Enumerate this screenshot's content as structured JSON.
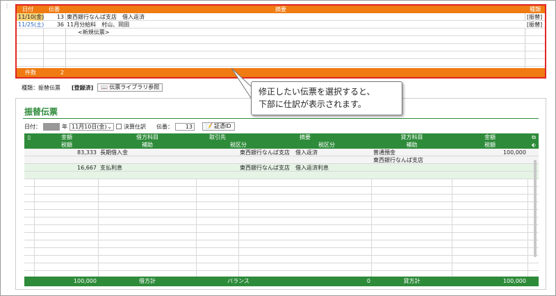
{
  "list": {
    "headers": {
      "date": "日付",
      "slip_no": "伝番",
      "summary": "摘要",
      "kind": "種類"
    },
    "rows": [
      {
        "date": "11/10(金)",
        "slip_no": "13",
        "summary": "東西銀行なんば支店　借入返済",
        "kind": "[振替]"
      },
      {
        "date": "11/25(土)",
        "slip_no": "36",
        "summary": "11月分給料　村山、岡田",
        "kind": "[振替]"
      },
      {
        "date": "",
        "slip_no": "",
        "summary": "<新規伝票>",
        "kind": ""
      }
    ],
    "footer": {
      "label": "件数",
      "count": "2"
    }
  },
  "info": {
    "kind": "種類：振替伝票",
    "status": "[登録済]",
    "library_button": "伝票ライブラリ参照"
  },
  "callout": {
    "line1": "修正したい伝票を選択すると、",
    "line2": "下部に仕訳が表示されます。"
  },
  "form": {
    "title": "振替伝票",
    "date_label": "日付：",
    "year_suffix": "年",
    "date_value": "11月10日(金)",
    "closing_label": "決算仕訳",
    "slip_label": "伝番：",
    "slip_value": "13",
    "voucher_id": "証憑ID"
  },
  "grid": {
    "head1": {
      "amount": "金額",
      "debit_account": "借方科目",
      "partner": "取引先",
      "summary": "摘要",
      "credit_account": "貸方科目",
      "amount2": "金額"
    },
    "head2": {
      "tax": "税額",
      "aux": "補助",
      "tax_cat": "税区分",
      "tax_cat2": "税区分",
      "aux2": "補助",
      "tax2": "税額"
    },
    "rows": [
      {
        "amount": "83,333",
        "debit": "長期借入金",
        "summary": "東西銀行なんば支店　借入返済",
        "credit": "普通預金",
        "amount2": "100,000"
      },
      {
        "amount": "",
        "debit": "",
        "summary": "",
        "credit": "東西銀行なんば支店",
        "amount2": ""
      },
      {
        "amount": "16,667",
        "debit": "支払利息",
        "summary": "東西銀行なんば支店　借入返済利息",
        "credit": "",
        "amount2": ""
      }
    ],
    "footer": {
      "debit_total": "100,000",
      "debit_label": "借方計",
      "balance_label": "バランス",
      "balance": "0",
      "credit_label": "貸方計",
      "credit_total": "100,000"
    }
  },
  "colors": {
    "orange": "#ef7b12",
    "green": "#2e8b3a",
    "red": "#e02424"
  }
}
